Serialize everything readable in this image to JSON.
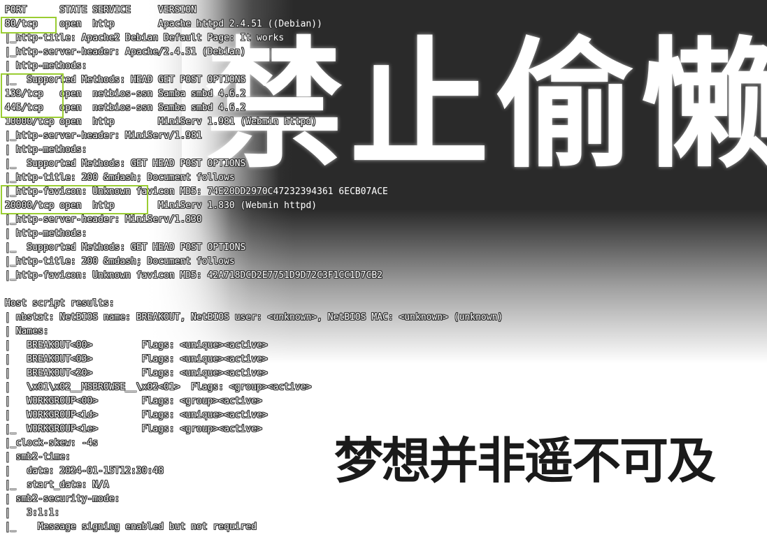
{
  "wallpaper": {
    "big_text": "禁止偷懒",
    "slogan": "梦想并非遥不可及"
  },
  "terminal": {
    "lines": [
      "PORT      STATE SERVICE     VERSION",
      "80/tcp    open  http        Apache httpd 2.4.51 ((Debian))",
      "|_http-title: Apache2 Debian Default Page: It works",
      "|_http-server-header: Apache/2.4.51 (Debian)",
      "| http-methods:",
      "|_  Supported Methods: HEAD GET POST OPTIONS",
      "139/tcp   open  netbios-ssn Samba smbd 4.6.2",
      "445/tcp   open  netbios-ssn Samba smbd 4.6.2",
      "10000/tcp open  http        MiniServ 1.981 (Webmin httpd)",
      "|_http-server-header: MiniServ/1.981",
      "| http-methods:",
      "|_  Supported Methods: GET HEAD POST OPTIONS",
      "|_http-title: 200 &mdash; Document follows",
      "|_http-favicon: Unknown favicon MD5: 74E20DD2970C47232394361 6ECB07ACE",
      "20000/tcp open  http        MiniServ 1.830 (Webmin httpd)",
      "|_http-server-header: MiniServ/1.830",
      "| http-methods:",
      "|_  Supported Methods: GET HEAD POST OPTIONS",
      "|_http-title: 200 &mdash; Document follows",
      "|_http-favicon: Unknown favicon MD5: 42A718DCD2E7751D9D72C3F1CC1D7CB2",
      "",
      "Host script results:",
      "| nbstat: NetBIOS name: BREAKOUT, NetBIOS user: <unknown>, NetBIOS MAC: <unknown> (unknown)",
      "| Names:",
      "|   BREAKOUT<00>         Flags: <unique><active>",
      "|   BREAKOUT<03>         Flags: <unique><active>",
      "|   BREAKOUT<20>         Flags: <unique><active>",
      "|   \\x01\\x02__MSBROWSE__\\x02<01>  Flags: <group><active>",
      "|   WORKGROUP<00>        Flags: <group><active>",
      "|   WORKGROUP<1d>        Flags: <unique><active>",
      "|_  WORKGROUP<1e>        Flags: <group><active>",
      "|_clock-skew: -4s",
      "| smb2-time:",
      "|   date: 2024-01-15T12:30:48",
      "|_  start_date: N/A",
      "| smb2-security-mode:",
      "|   3:1:1:",
      "|_    Message signing enabled but not required"
    ]
  },
  "highlight_color": "#9acd32"
}
